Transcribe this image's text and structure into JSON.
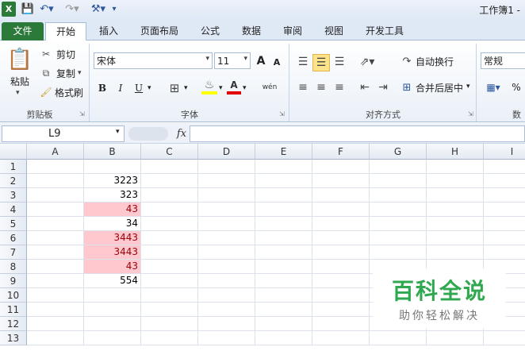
{
  "app": {
    "title": "工作簿1 -"
  },
  "tabs": [
    {
      "label": "文件"
    },
    {
      "label": "开始"
    },
    {
      "label": "插入"
    },
    {
      "label": "页面布局"
    },
    {
      "label": "公式"
    },
    {
      "label": "数据"
    },
    {
      "label": "审阅"
    },
    {
      "label": "视图"
    },
    {
      "label": "开发工具"
    }
  ],
  "clipboard": {
    "paste": "粘贴",
    "cut": "剪切",
    "copy": "复制",
    "format_painter": "格式刷",
    "label": "剪贴板"
  },
  "font": {
    "name": "宋体",
    "size": "11",
    "label": "字体",
    "bold": "B",
    "italic": "I",
    "underline": "U",
    "grow": "A",
    "shrink": "A",
    "font_color": "A",
    "phonetic": "wén"
  },
  "alignment": {
    "wrap": "自动换行",
    "merge": "合并后居中",
    "label": "对齐方式"
  },
  "number": {
    "format": "常规",
    "label": "数",
    "percent": "%"
  },
  "formula_bar": {
    "name_box": "L9",
    "fx": "fx",
    "value": ""
  },
  "columns": [
    "A",
    "B",
    "C",
    "D",
    "E",
    "F",
    "G",
    "H",
    "I"
  ],
  "rows": [
    "1",
    "2",
    "3",
    "4",
    "5",
    "6",
    "7",
    "8",
    "9",
    "10",
    "11",
    "12",
    "13"
  ],
  "cells_b": [
    "",
    "3223",
    "323",
    "43",
    "34",
    "3443",
    "3443",
    "43",
    "554",
    "",
    "",
    "",
    ""
  ],
  "highlight_rows": [
    4,
    6,
    7,
    8
  ],
  "highlight_color": "#ffc7ce",
  "watermark": {
    "big": "百科全说",
    "small": "助你轻松解决"
  }
}
